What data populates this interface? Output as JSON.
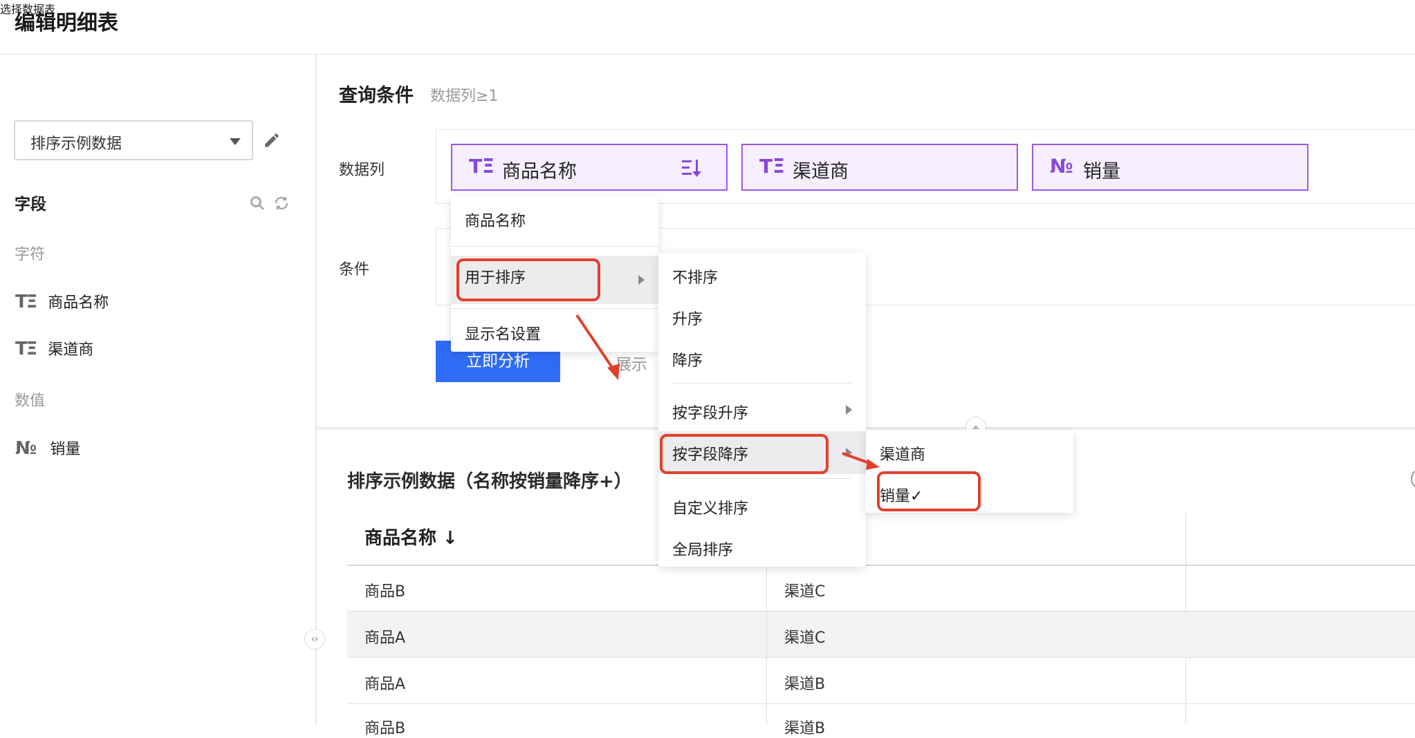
{
  "header": {
    "title": "编辑明细表"
  },
  "left_panel": {
    "section_title": "选择数据表",
    "dataset_select": {
      "value": "排序示例数据"
    },
    "fields_title": "字段",
    "groups": [
      {
        "label": "字符",
        "items": [
          {
            "icon": "text-type-icon",
            "glyph": "TΞ",
            "label": "商品名称"
          },
          {
            "icon": "text-type-icon",
            "glyph": "TΞ",
            "label": "渠道商"
          }
        ]
      },
      {
        "label": "数值",
        "items": [
          {
            "icon": "number-type-icon",
            "glyph": "№",
            "label": "销量"
          }
        ]
      }
    ]
  },
  "query": {
    "title": "查询条件",
    "hint": "数据列≥1",
    "columns_label": "数据列",
    "conditions_label": "条件",
    "chips": [
      {
        "glyph": "TΞ",
        "label": "商品名称"
      },
      {
        "glyph": "TΞ",
        "label": "渠道商"
      },
      {
        "glyph": "№",
        "label": "销量"
      }
    ],
    "analyze_button": "立即分析",
    "show_text": "展示"
  },
  "context_menu": {
    "items": [
      "商品名称",
      "用于排序",
      "显示名设置"
    ]
  },
  "sort_menu": {
    "items": [
      "不排序",
      "升序",
      "降序",
      "按字段升序",
      "按字段降序",
      "自定义排序",
      "全局排序"
    ]
  },
  "field_menu": {
    "items": [
      "渠道商",
      "销量✓"
    ]
  },
  "table": {
    "title": "排序示例数据（名称按销量降序+）",
    "headers": [
      "商品名称 ↓",
      "",
      ""
    ],
    "rows": [
      [
        "商品B",
        "渠道C"
      ],
      [
        "商品A",
        "渠道C"
      ],
      [
        "商品A",
        "渠道B"
      ],
      [
        "商品B",
        "渠道B"
      ]
    ]
  },
  "colors": {
    "accent_purple": "#9b57e8",
    "primary_blue": "#2f6cf6",
    "annotation_red": "#e2402c"
  }
}
